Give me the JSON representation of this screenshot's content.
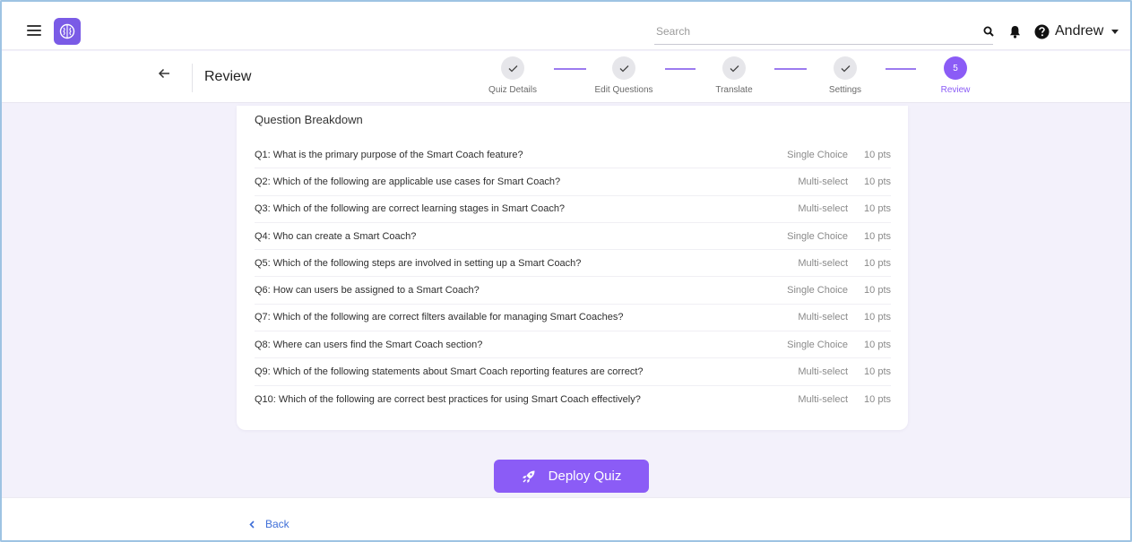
{
  "header": {
    "search_placeholder": "Search",
    "user_name": "Andrew"
  },
  "page": {
    "title": "Review"
  },
  "stepper": {
    "steps": [
      {
        "label": "Quiz Details",
        "state": "done"
      },
      {
        "label": "Edit Questions",
        "state": "done"
      },
      {
        "label": "Translate",
        "state": "done"
      },
      {
        "label": "Settings",
        "state": "done"
      },
      {
        "label": "Review",
        "state": "active",
        "number": "5"
      }
    ]
  },
  "breakdown": {
    "title": "Question Breakdown",
    "questions": [
      {
        "text": "Q1: What is the primary purpose of the Smart Coach feature?",
        "type": "Single Choice",
        "points": "10 pts"
      },
      {
        "text": "Q2: Which of the following are applicable use cases for Smart Coach?",
        "type": "Multi-select",
        "points": "10 pts"
      },
      {
        "text": "Q3: Which of the following are correct learning stages in Smart Coach?",
        "type": "Multi-select",
        "points": "10 pts"
      },
      {
        "text": "Q4: Who can create a Smart Coach?",
        "type": "Single Choice",
        "points": "10 pts"
      },
      {
        "text": "Q5: Which of the following steps are involved in setting up a Smart Coach?",
        "type": "Multi-select",
        "points": "10 pts"
      },
      {
        "text": "Q6: How can users be assigned to a Smart Coach?",
        "type": "Single Choice",
        "points": "10 pts"
      },
      {
        "text": "Q7: Which of the following are correct filters available for managing Smart Coaches?",
        "type": "Multi-select",
        "points": "10 pts"
      },
      {
        "text": "Q8: Where can users find the Smart Coach section?",
        "type": "Single Choice",
        "points": "10 pts"
      },
      {
        "text": "Q9: Which of the following statements about Smart Coach reporting features are correct?",
        "type": "Multi-select",
        "points": "10 pts"
      },
      {
        "text": "Q10: Which of the following are correct best practices for using Smart Coach effectively?",
        "type": "Multi-select",
        "points": "10 pts"
      }
    ]
  },
  "actions": {
    "deploy_label": "Deploy Quiz",
    "back_label": "Back"
  },
  "colors": {
    "accent": "#8b5cf6",
    "link": "#3f6fd8",
    "background": "#f3f1fb"
  }
}
